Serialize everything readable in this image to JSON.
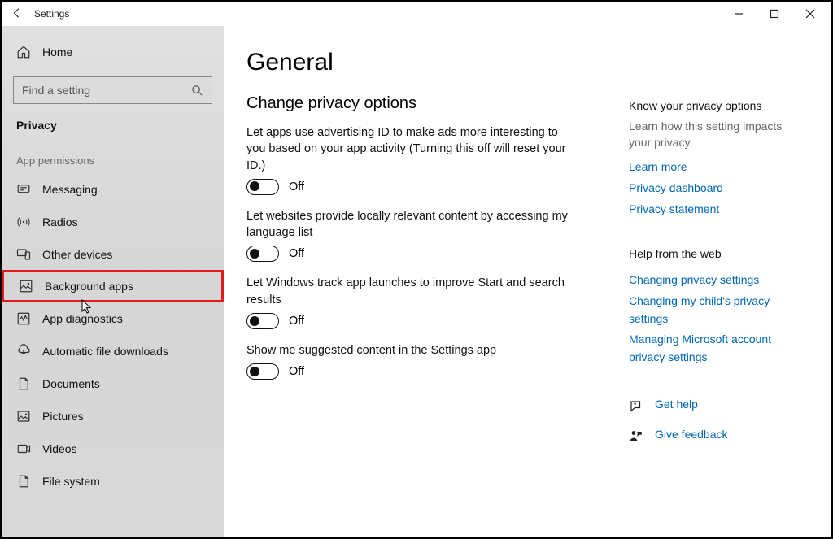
{
  "titlebar": {
    "title": "Settings"
  },
  "sidebar": {
    "home_label": "Home",
    "search_placeholder": "Find a setting",
    "section_title": "Privacy",
    "group_label": "App permissions",
    "items": [
      {
        "icon": "messaging-icon",
        "label": "Messaging"
      },
      {
        "icon": "radio-icon",
        "label": "Radios"
      },
      {
        "icon": "devices-icon",
        "label": "Other devices"
      },
      {
        "icon": "background-apps-icon",
        "label": "Background apps",
        "highlighted": true
      },
      {
        "icon": "diagnostics-icon",
        "label": "App diagnostics"
      },
      {
        "icon": "download-icon",
        "label": "Automatic file downloads"
      },
      {
        "icon": "documents-icon",
        "label": "Documents"
      },
      {
        "icon": "pictures-icon",
        "label": "Pictures"
      },
      {
        "icon": "videos-icon",
        "label": "Videos"
      },
      {
        "icon": "filesystem-icon",
        "label": "File system"
      }
    ]
  },
  "main": {
    "title": "General",
    "subtitle": "Change privacy options",
    "options": [
      {
        "label": "Let apps use advertising ID to make ads more interesting to you based on your app activity (Turning this off will reset your ID.)",
        "state": "Off"
      },
      {
        "label": "Let websites provide locally relevant content by accessing my language list",
        "state": "Off"
      },
      {
        "label": "Let Windows track app launches to improve Start and search results",
        "state": "Off"
      },
      {
        "label": "Show me suggested content in the Settings app",
        "state": "Off"
      }
    ]
  },
  "aside": {
    "privacy_heading": "Know your privacy options",
    "privacy_muted": "Learn how this setting impacts your privacy.",
    "learn_more": "Learn more",
    "privacy_dashboard": "Privacy dashboard",
    "privacy_statement": "Privacy statement",
    "help_heading": "Help from the web",
    "help_links": [
      "Changing privacy settings",
      "Changing my child's privacy settings",
      "Managing Microsoft account privacy settings"
    ],
    "get_help": "Get help",
    "give_feedback": "Give feedback"
  }
}
